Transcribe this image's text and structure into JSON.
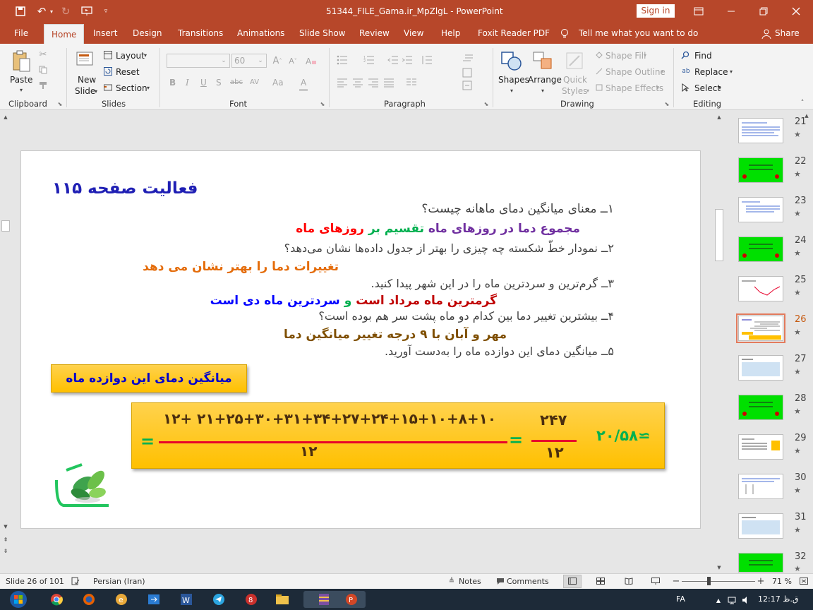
{
  "window": {
    "title": "51344_FILE_Gama.ir_MpZlgL  -  PowerPoint",
    "signin": "Sign in"
  },
  "tabs": [
    "File",
    "Home",
    "Insert",
    "Design",
    "Transitions",
    "Animations",
    "Slide Show",
    "Review",
    "View",
    "Help",
    "Foxit Reader PDF"
  ],
  "tell_me": "Tell me what you want to do",
  "share": "Share",
  "ribbon": {
    "paste": "Paste",
    "new_slide": "New",
    "new_slide2": "Slide",
    "layout": "Layout",
    "reset": "Reset",
    "section": "Section",
    "font_size": "60",
    "shapes": "Shapes",
    "arrange": "Arrange",
    "quick_styles": "Quick",
    "quick_styles2": "Styles",
    "shape_fill": "Shape Fill",
    "shape_outline": "Shape Outline",
    "shape_effects": "Shape Effects",
    "find": "Find",
    "replace": "Replace",
    "select": "Select",
    "groups": [
      "Clipboard",
      "Slides",
      "Font",
      "Paragraph",
      "Drawing",
      "Editing"
    ]
  },
  "slide": {
    "title": "فعالیت  صفحه ۱۱۵",
    "q1": "۱ــ معنای میانگین دمای ماهانه چیست؟",
    "a1_part1": "مجموع دما در روزهای ماه",
    "a1_part2": "تقسیم بر",
    "a1_part3": "روزهای ماه",
    "q2": "۲ــ نمودار خطّ شکسته چه چیزی را بهتر از جدول داده‌ها نشان می‌دهد؟",
    "a2": "تغییرات دما را بهتر نشان می دهد",
    "q3": "۳ــ گرم‌ترین و سردترین ماه را در این شهر پیدا کنید.",
    "a3_part1": "گرمترین ماه مرداد است",
    "a3_part2": "و",
    "a3_part3": "سردترین ماه دی است",
    "q4": "۴ــ بیشترین تغییر دما بین کدام دو ماه پشت سر هم بوده است؟",
    "a4": "مهر و آبان با ۹ درجه تغییر میانگین دما",
    "q5": "۵ــ میانگین دمای این دوازده ماه را به‌دست آورید.",
    "box_label": "میانگین دمای این دوازده ماه",
    "numerator": "۲۱+۲۵+۳۰+۳۱+۳۴+۲۷+۲۴+۱۵+۱۰+۸+۱۰ +۱۲",
    "denominator": "۱۲",
    "sum_num": "۲۴۷",
    "sum_den": "۱۲",
    "equals": "=",
    "result": "≃۲۰/۵۸"
  },
  "thumbnails": [
    {
      "num": "21",
      "star": "★",
      "type": "text"
    },
    {
      "num": "22",
      "star": "★",
      "type": "green"
    },
    {
      "num": "23",
      "star": "★",
      "type": "text"
    },
    {
      "num": "24",
      "star": "★",
      "type": "green"
    },
    {
      "num": "25",
      "star": "★",
      "type": "chart"
    },
    {
      "num": "26",
      "star": "★",
      "type": "current"
    },
    {
      "num": "27",
      "star": "★",
      "type": "blue"
    },
    {
      "num": "28",
      "star": "★",
      "type": "green"
    },
    {
      "num": "29",
      "star": "★",
      "type": "table"
    },
    {
      "num": "30",
      "star": "★",
      "type": "text"
    },
    {
      "num": "31",
      "star": "★",
      "type": "blue"
    },
    {
      "num": "32",
      "star": "★",
      "type": "green"
    }
  ],
  "status": {
    "slide_info": "Slide 26 of 101",
    "language": "Persian (Iran)",
    "notes": "Notes",
    "comments": "Comments",
    "zoom": "71 %"
  },
  "taskbar": {
    "lang": "FA",
    "time": "12:17 ق.ظ"
  },
  "colors": {
    "accent": "#b7472a",
    "purple": "#7030a0",
    "green": "#00b050",
    "red": "#ff0000",
    "orange": "#e46c0a",
    "blue": "#0000ff",
    "maroon": "#c00000",
    "brown": "#7f4f00",
    "yellow": "#ffc000"
  }
}
